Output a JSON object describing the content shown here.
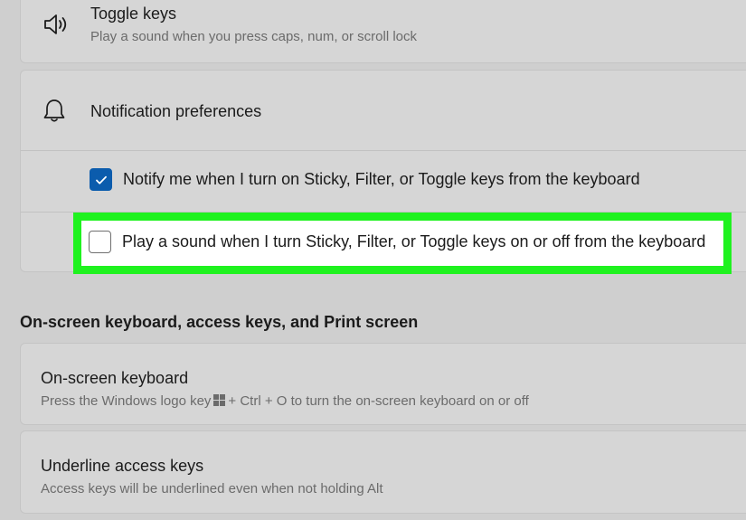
{
  "toggle_keys": {
    "title": "Toggle keys",
    "subtitle": "Play a sound when you press caps, num, or scroll lock",
    "icon": "speaker-icon"
  },
  "notification_preferences": {
    "title": "Notification preferences",
    "icon": "bell-icon",
    "options": [
      {
        "label": "Notify me when I turn on Sticky, Filter, or Toggle keys from the keyboard",
        "checked": true
      },
      {
        "label": "Play a sound when I turn Sticky, Filter, or Toggle keys on or off from the keyboard",
        "checked": false
      }
    ]
  },
  "section": {
    "heading": "On-screen keyboard, access keys, and Print screen"
  },
  "on_screen_keyboard": {
    "title": "On-screen keyboard",
    "subtitle_before": "Press the Windows logo key",
    "subtitle_after": "+ Ctrl + O to turn the on-screen keyboard on or off"
  },
  "underline_access_keys": {
    "title": "Underline access keys",
    "subtitle": "Access keys will be underlined even when not holding Alt"
  },
  "colors": {
    "accent": "#0b5cad",
    "highlight": "#1ff21f"
  }
}
